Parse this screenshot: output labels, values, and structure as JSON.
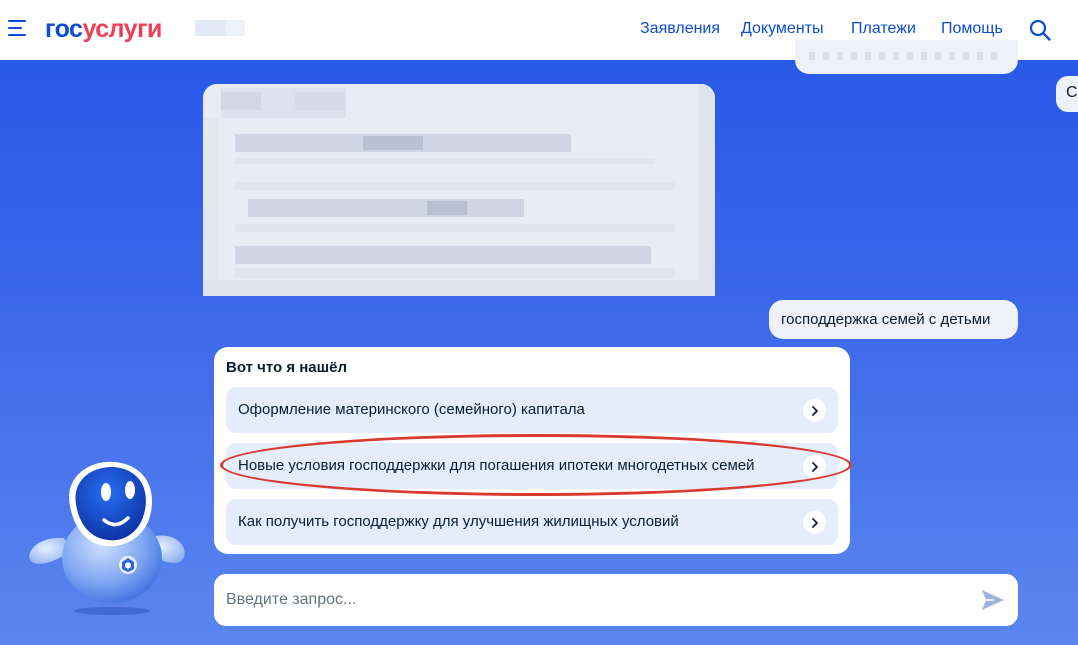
{
  "header": {
    "logo_part1": "гос",
    "logo_part2": "услуги",
    "nav": [
      "Заявления",
      "Документы",
      "Платежи",
      "Помощь"
    ],
    "menu_icon": "burger-menu-icon",
    "search_icon": "search-icon"
  },
  "chat": {
    "right_edge_char": "С",
    "user_message": "господдержка семей с детьми",
    "results_title": "Вот что я нашёл",
    "options": [
      "Оформление материнского (семейного) капитала",
      "Новые условия господдержки для погашения ипотеки многодетных семей",
      "Как получить господдержку для улучшения жилищных условий"
    ],
    "option_icon": "chevron-right-icon"
  },
  "input": {
    "placeholder": "Введите запрос...",
    "send_icon": "send-icon"
  },
  "colors": {
    "brand_blue": "#0d4cd3",
    "brand_red": "#ee3f58",
    "background_blue": "#2356e6",
    "highlight_red": "#d83a2f",
    "option_bg": "#e5ecfb"
  }
}
